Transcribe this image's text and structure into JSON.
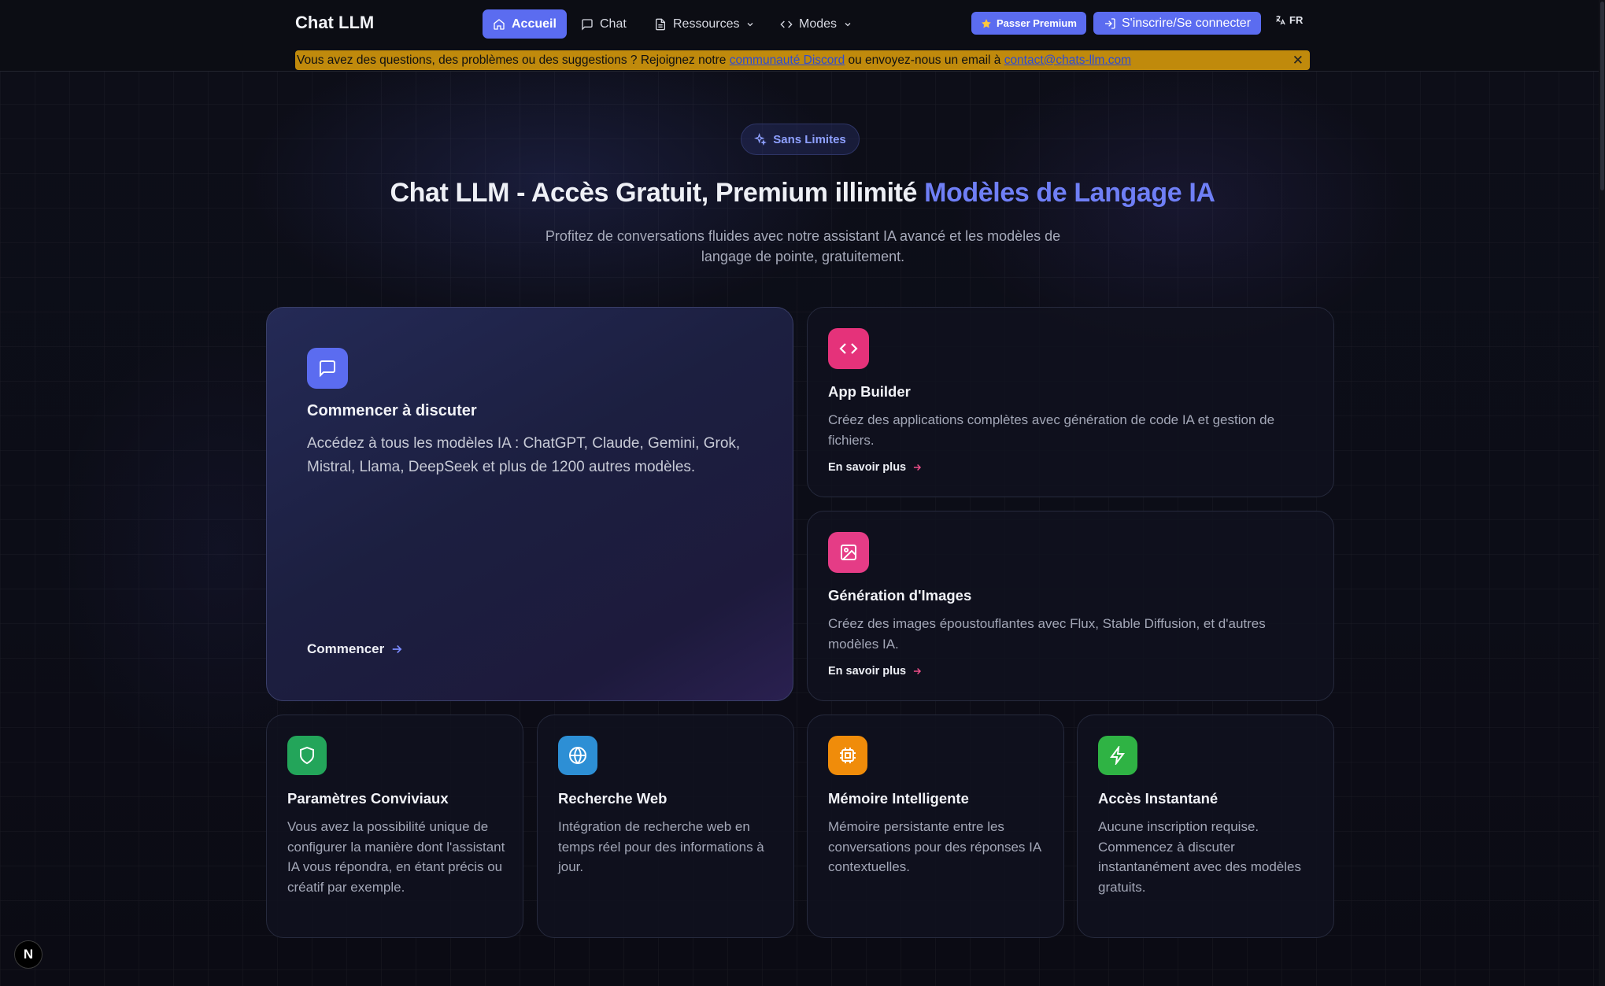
{
  "nav": {
    "brand": "Chat LLM",
    "items": [
      {
        "label": "Accueil",
        "icon": "home-icon",
        "active": true
      },
      {
        "label": "Chat",
        "icon": "message-icon"
      },
      {
        "label": "Ressources",
        "icon": "document-icon",
        "dropdown": true
      },
      {
        "label": "Modes",
        "icon": "code-icon",
        "dropdown": true
      }
    ],
    "premium_label": "Passer Premium",
    "login_label": "S'inscrire/Se connecter",
    "language": "FR"
  },
  "banner": {
    "text_before": "Vous avez des questions, des problèmes ou des suggestions ? Rejoignez notre ",
    "discord_link": "communauté Discord",
    "text_middle": " ou envoyez-nous un email à ",
    "email_link": "contact@chats-llm.com",
    "close": "✕"
  },
  "hero": {
    "badge": "Sans Limites",
    "title_main": "Chat LLM - Accès Gratuit, Premium illimité ",
    "title_accent": "Modèles de Langage IA",
    "subtitle": "Profitez de conversations fluides avec notre assistant IA avancé et les modèles de langage de pointe, gratuitement."
  },
  "cards": {
    "chat": {
      "title": "Commencer à discuter",
      "text": "Accédez à tous les modèles IA : ChatGPT, Claude, Gemini, Grok, Mistral, Llama, DeepSeek et plus de 1200 autres modèles.",
      "link": "Commencer"
    },
    "app_builder": {
      "title": "App Builder",
      "text": "Créez des applications complètes avec génération de code IA et gestion de fichiers.",
      "link": "En savoir plus"
    },
    "images": {
      "title": "Génération d'Images",
      "text": "Créez des images époustouflantes avec Flux, Stable Diffusion, et d'autres modèles IA.",
      "link": "En savoir plus"
    },
    "settings": {
      "title": "Paramètres Conviviaux",
      "text": "Vous avez la possibilité unique de configurer la manière dont l'assistant IA vous répondra, en étant précis ou créatif par exemple."
    },
    "web": {
      "title": "Recherche Web",
      "text": "Intégration de recherche web en temps réel pour des informations à jour."
    },
    "memory": {
      "title": "Mémoire Intelligente",
      "text": "Mémoire persistante entre les conversations pour des réponses IA contextuelles."
    },
    "instant": {
      "title": "Accès Instantané",
      "text": "Aucune inscription requise. Commencez à discuter instantanément avec des modèles gratuits."
    }
  },
  "dev_badge": "N",
  "colors": {
    "accent": "#5b6cf0",
    "banner": "#c08a0c",
    "chat_icon": "#5b6cf0",
    "app_icon": "#e5327a",
    "image_icon": "#e53c86",
    "settings_icon": "#23a55a",
    "web_icon": "#2d8fd5",
    "memory_icon": "#f08c0a",
    "instant_icon": "#2fb344"
  }
}
